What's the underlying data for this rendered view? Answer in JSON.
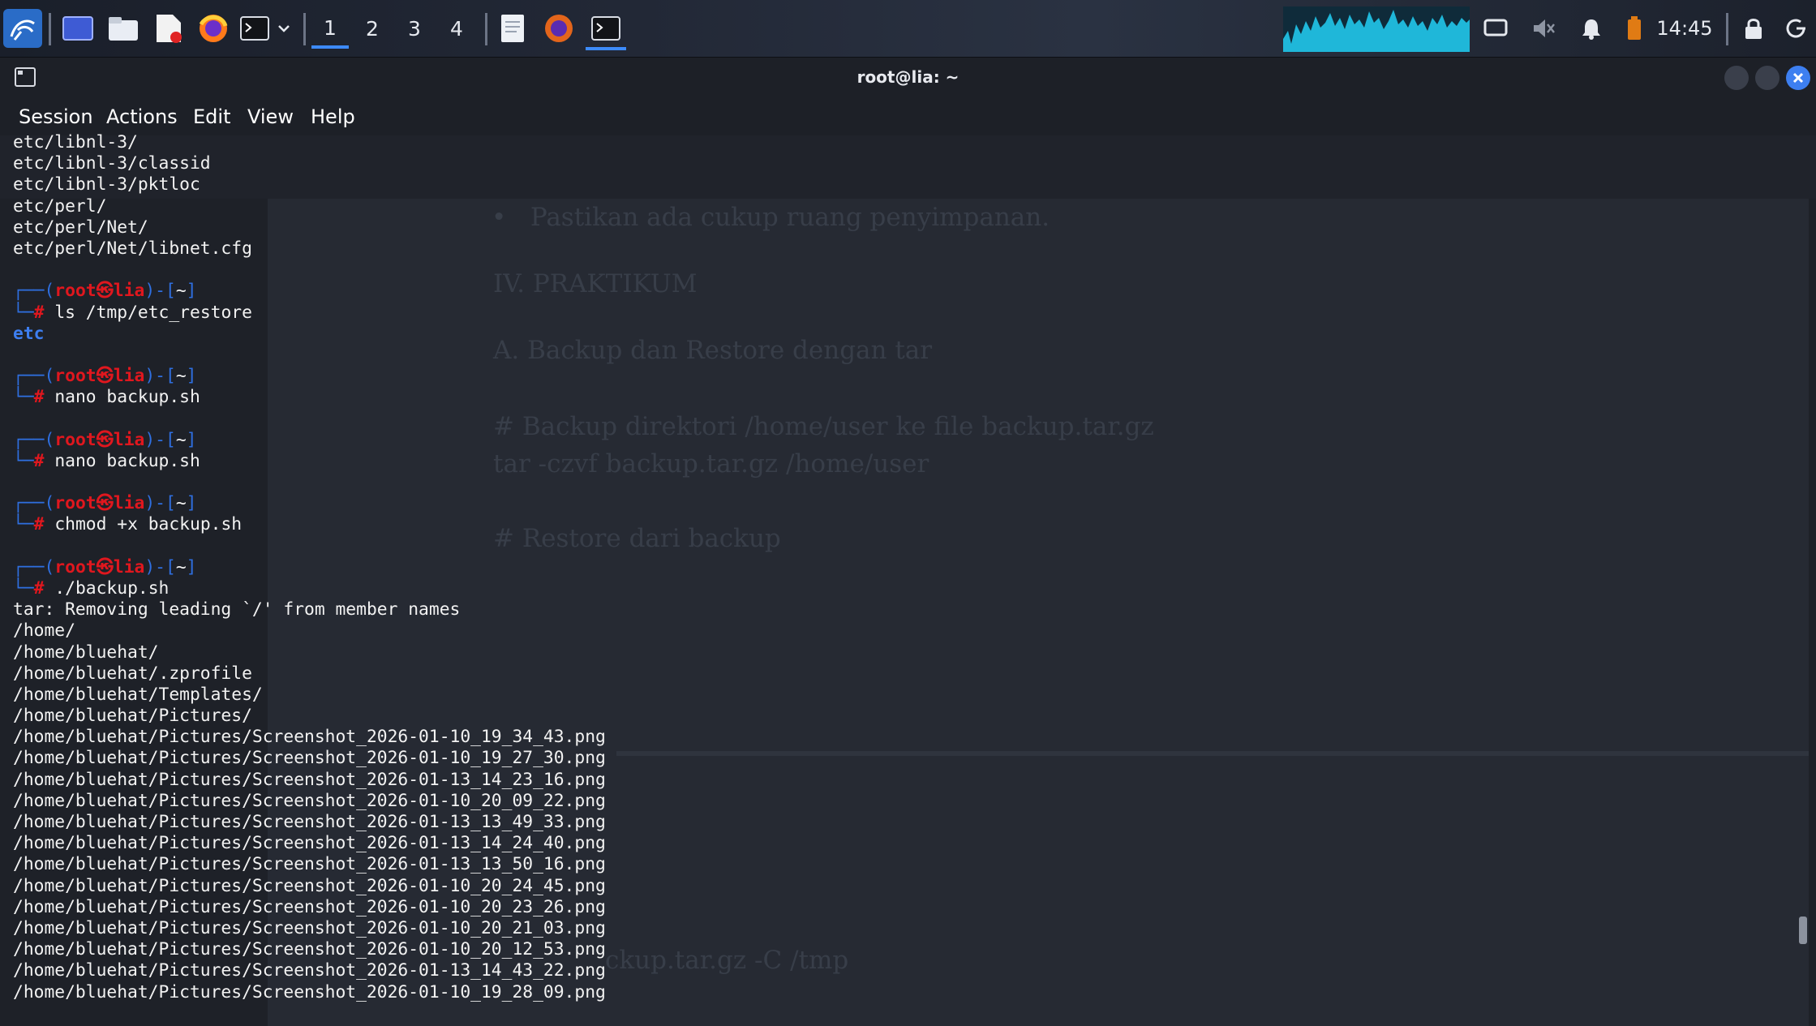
{
  "taskbar": {
    "workspaces": [
      "1",
      "2",
      "3",
      "4"
    ],
    "active_workspace": "1",
    "clock": "14:45",
    "icons": [
      "kali-menu-icon",
      "desktop-icon",
      "file-manager-icon",
      "text-editor-icon",
      "firefox-icon",
      "terminal-icon",
      "chevron-down-icon",
      "notes-app-icon",
      "firefox-window-icon",
      "terminal-window-icon",
      "cpu-graph",
      "display-icon",
      "speaker-muted-icon",
      "bell-icon",
      "battery-icon",
      "lock-icon",
      "power-icon"
    ]
  },
  "window": {
    "title": "root@lia: ~",
    "menu": [
      "Session",
      "Actions",
      "Edit",
      "View",
      "Help"
    ]
  },
  "background_doc": {
    "bullet": "Pastikan ada cukup ruang penyimpanan.",
    "heading": "IV. PRAKTIKUM",
    "subheading": "A. Backup dan Restore dengan tar",
    "comment1": "# Backup direktori /home/user ke file backup.tar.gz",
    "cmd1": "tar -czvf backup.tar.gz /home/user",
    "comment2": "# Restore dari backup",
    "cmd2": "ckup.tar.gz -C /tmp"
  },
  "terminal": {
    "prompt_user": "root",
    "prompt_at": "㉿",
    "prompt_host": "lia",
    "prompt_dir": "~",
    "lines": [
      {
        "t": "out",
        "text": "etc/libnl-3/"
      },
      {
        "t": "out",
        "text": "etc/libnl-3/classid"
      },
      {
        "t": "out",
        "text": "etc/libnl-3/pktloc"
      },
      {
        "t": "out",
        "text": "etc/perl/"
      },
      {
        "t": "out",
        "text": "etc/perl/Net/"
      },
      {
        "t": "out",
        "text": "etc/perl/Net/libnet.cfg"
      },
      {
        "t": "blank",
        "text": ""
      },
      {
        "t": "prompt",
        "text": ""
      },
      {
        "t": "cmd",
        "text": "ls /tmp/etc_restore"
      },
      {
        "t": "dir",
        "text": "etc"
      },
      {
        "t": "blank",
        "text": ""
      },
      {
        "t": "prompt",
        "text": ""
      },
      {
        "t": "cmd",
        "text": "nano backup.sh"
      },
      {
        "t": "blank",
        "text": ""
      },
      {
        "t": "prompt",
        "text": ""
      },
      {
        "t": "cmd",
        "text": "nano backup.sh"
      },
      {
        "t": "blank",
        "text": ""
      },
      {
        "t": "prompt",
        "text": ""
      },
      {
        "t": "cmd",
        "text": "chmod +x backup.sh"
      },
      {
        "t": "blank",
        "text": ""
      },
      {
        "t": "prompt",
        "text": ""
      },
      {
        "t": "cmd",
        "text": "./backup.sh"
      },
      {
        "t": "out",
        "text": "tar: Removing leading `/' from member names"
      },
      {
        "t": "out",
        "text": "/home/"
      },
      {
        "t": "out",
        "text": "/home/bluehat/"
      },
      {
        "t": "out",
        "text": "/home/bluehat/.zprofile"
      },
      {
        "t": "out",
        "text": "/home/bluehat/Templates/"
      },
      {
        "t": "out",
        "text": "/home/bluehat/Pictures/"
      },
      {
        "t": "out",
        "text": "/home/bluehat/Pictures/Screenshot_2026-01-10_19_34_43.png"
      },
      {
        "t": "out",
        "text": "/home/bluehat/Pictures/Screenshot_2026-01-10_19_27_30.png"
      },
      {
        "t": "out",
        "text": "/home/bluehat/Pictures/Screenshot_2026-01-13_14_23_16.png"
      },
      {
        "t": "out",
        "text": "/home/bluehat/Pictures/Screenshot_2026-01-10_20_09_22.png"
      },
      {
        "t": "out",
        "text": "/home/bluehat/Pictures/Screenshot_2026-01-13_13_49_33.png"
      },
      {
        "t": "out",
        "text": "/home/bluehat/Pictures/Screenshot_2026-01-13_14_24_40.png"
      },
      {
        "t": "out",
        "text": "/home/bluehat/Pictures/Screenshot_2026-01-13_13_50_16.png"
      },
      {
        "t": "out",
        "text": "/home/bluehat/Pictures/Screenshot_2026-01-10_20_24_45.png"
      },
      {
        "t": "out",
        "text": "/home/bluehat/Pictures/Screenshot_2026-01-10_20_23_26.png"
      },
      {
        "t": "out",
        "text": "/home/bluehat/Pictures/Screenshot_2026-01-10_20_21_03.png"
      },
      {
        "t": "out",
        "text": "/home/bluehat/Pictures/Screenshot_2026-01-10_20_12_53.png"
      },
      {
        "t": "out",
        "text": "/home/bluehat/Pictures/Screenshot_2026-01-13_14_43_22.png"
      },
      {
        "t": "out",
        "text": "/home/bluehat/Pictures/Screenshot_2026-01-10_19_28_09.png"
      }
    ]
  },
  "colors": {
    "accent": "#3d8bfd",
    "prompt_red": "#e0171e",
    "prompt_blue": "#2f6fe0",
    "terminal_bg": "#1e2128"
  }
}
